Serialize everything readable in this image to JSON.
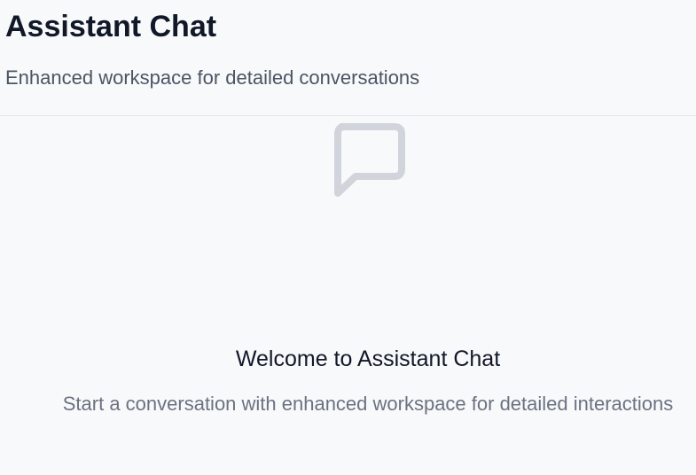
{
  "header": {
    "title": "Assistant Chat",
    "subtitle": "Enhanced workspace for detailed conversations"
  },
  "empty_state": {
    "icon": "message-square-icon",
    "title": "Welcome to Assistant Chat",
    "description": "Start a conversation with enhanced workspace for detailed interactions"
  },
  "colors": {
    "background": "#f8f9fb",
    "title": "#111827",
    "subtitle": "#4b5563",
    "muted_text": "#6b7280",
    "icon": "#d1d5db",
    "divider": "#e5e7eb"
  }
}
